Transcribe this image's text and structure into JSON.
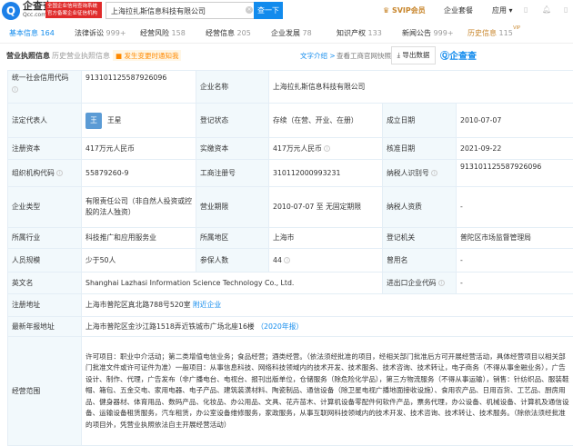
{
  "header": {
    "logo_name": "企查查",
    "logo_domain": "Qcc.com",
    "badge_line1": "全国企业信用查询系统",
    "badge_line2": "官方备案企业征信机构",
    "search_value": "上海拉扎斯信息科技有限公司",
    "search_button": "查一下",
    "svip": "SVIP会员",
    "package": "企业套餐",
    "apps": "应用"
  },
  "tabs": [
    {
      "label": "基本信息",
      "count": "164"
    },
    {
      "label": "法律诉讼",
      "count": "999+"
    },
    {
      "label": "经营风险",
      "count": "158"
    },
    {
      "label": "经营信息",
      "count": "205"
    },
    {
      "label": "企业发展",
      "count": "78"
    },
    {
      "label": "知识产权",
      "count": "133"
    },
    {
      "label": "新闻公告",
      "count": "999+"
    },
    {
      "label": "历史信息",
      "count": "115",
      "badge": "VIP"
    }
  ],
  "section": {
    "title": "营业执照信息",
    "history": "历史营业执照信息 1",
    "notify": "发生变更时通知我",
    "text_intro": "文字介绍 >",
    "view_snapshot": "查看工商官网快照",
    "export": "导出数据",
    "watermark": "企查查"
  },
  "info": {
    "credit_code_label": "统一社会信用代码",
    "credit_code": "913101125587926096",
    "name_label": "企业名称",
    "name": "上海拉扎斯信息科技有限公司",
    "legal_rep_label": "法定代表人",
    "legal_rep_avatar": "王",
    "legal_rep": "王星",
    "status_label": "登记状态",
    "status": "存续（在营、开业、在册）",
    "founded_label": "成立日期",
    "founded": "2010-07-07",
    "reg_capital_label": "注册资本",
    "reg_capital": "417万元人民币",
    "paid_capital_label": "实缴资本",
    "paid_capital": "417万元人民币",
    "approved_label": "核准日期",
    "approved": "2021-09-22",
    "org_code_label": "组织机构代码",
    "org_code": "55879260-9",
    "biz_reg_label": "工商注册号",
    "biz_reg": "310112000993231",
    "taxpayer_id_label": "纳税人识别号",
    "taxpayer_id": "913101125587926096",
    "type_label": "企业类型",
    "type": "有限责任公司（非自然人投资或控股的法人独资）",
    "term_label": "营业期限",
    "term": "2010-07-07 至 无固定期限",
    "tax_qual_label": "纳税人资质",
    "tax_qual": "-",
    "industry_label": "所属行业",
    "industry": "科技推广和应用服务业",
    "region_label": "所属地区",
    "region": "上海市",
    "authority_label": "登记机关",
    "authority": "普陀区市场监督管理局",
    "staff_label": "人员规模",
    "staff": "少于50人",
    "insured_label": "参保人数",
    "insured": "44",
    "former_label": "曾用名",
    "former": "-",
    "en_label": "英文名",
    "en": "Shanghai Lazhasi Information Science Technology Co., Ltd.",
    "ie_label": "进出口企业代码",
    "ie": "-",
    "address_label": "注册地址",
    "address": "上海市普陀区真北路788号520室",
    "nearby": "附近企业",
    "annual_addr_label": "最新年报地址",
    "annual_addr": "上海市普陀区金沙江路1518弄近铁城市广场北座16楼",
    "annual_year": "（2020年报）",
    "scope_label": "经营范围",
    "scope": "许可项目：职业中介活动；第二类增值电信业务；食品经营；酒类经营。（依法须经批准的项目，经相关部门批准后方可开展经营活动，具体经营项目以相关部门批准文件或许可证件为准）一般项目：从事信息科技、网络科技领域内的技术开发、技术服务、技术咨询、技术转让，电子商务（不得从事金融业务），广告设计、制作、代理，广告发布（非广播电台、电视台、报刊出版单位，仓储服务（除危险化学品），第三方物流服务（不得从事运输），销售：针纺织品、服装鞋帽、箱包、五金交电、家用电器、电子产品、建筑装潢材料、陶瓷制品、通信设备（除卫星电视广播地面接收设施）、食用农产品、日用百货、工艺品、厨房用品、健身器材、体育用品、数码产品、化妆品、办公用品、文具、花卉苗木、计算机设备零配件何软件产品，票务代理，办公设备、机械设备、计算机及通信设备、运输设备租赁服务，汽车租赁，办公室设备维修服务，家政服务，从事互联网科技领域内的技术开发、技术咨询、技术转让、技术服务。（除依法须经批准的项目外，凭营业执照依法自主开展经营活动）"
  }
}
